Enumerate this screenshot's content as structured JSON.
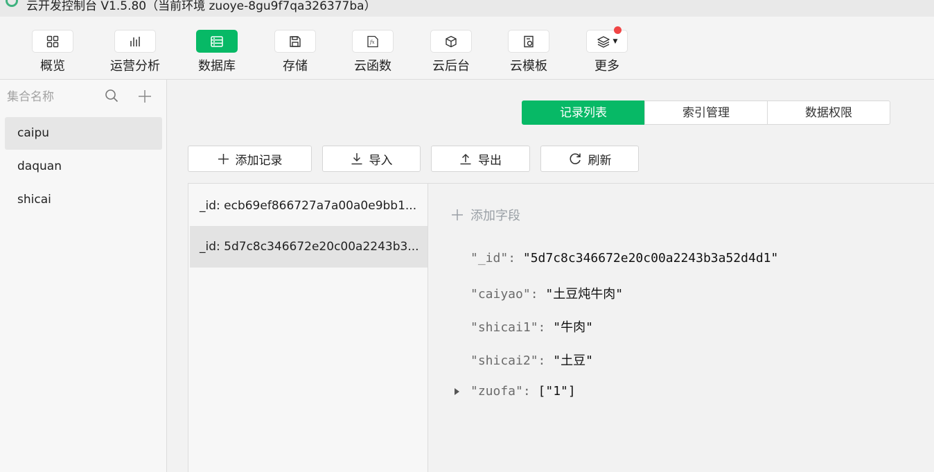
{
  "window": {
    "title": "云开发控制台 V1.5.80（当前环境 zuoye-8gu9f7qa326377ba）"
  },
  "toolbar": {
    "items": [
      {
        "label": "概览",
        "icon": "overview-grid-icon"
      },
      {
        "label": "运营分析",
        "icon": "bar-chart-icon"
      },
      {
        "label": "数据库",
        "icon": "database-icon"
      },
      {
        "label": "存储",
        "icon": "storage-save-icon"
      },
      {
        "label": "云函数",
        "icon": "function-fx-icon"
      },
      {
        "label": "云后台",
        "icon": "cube-icon"
      },
      {
        "label": "云模板",
        "icon": "template-icon"
      },
      {
        "label": "更多",
        "icon": "layers-icon"
      }
    ],
    "active": "数据库",
    "accent_color": "#07b966",
    "notification_dot_color": "#f04545"
  },
  "sidebar": {
    "search_placeholder": "集合名称",
    "collections": [
      {
        "name": "caipu",
        "selected": true
      },
      {
        "name": "daquan",
        "selected": false
      },
      {
        "name": "shicai",
        "selected": false
      }
    ]
  },
  "main": {
    "tabs": [
      {
        "label": "记录列表",
        "active": true
      },
      {
        "label": "索引管理",
        "active": false
      },
      {
        "label": "数据权限",
        "active": false
      }
    ],
    "actions": {
      "add_record": "添加记录",
      "import": "导入",
      "export": "导出",
      "refresh": "刷新"
    },
    "records": [
      {
        "label": "_id: ecb69ef866727a7a00a0e9bb1...",
        "selected": false
      },
      {
        "label": "_id: 5d7c8c346672e20c00a2243b3...",
        "selected": true
      }
    ],
    "detail": {
      "add_field": "添加字段",
      "fields": [
        {
          "key": "\"_id\"",
          "value": "\"5d7c8c346672e20c00a2243b3a52d4d1\"",
          "expandable": false
        },
        {
          "key": "\"caiyao\"",
          "value": "\"土豆炖牛肉\"",
          "expandable": false
        },
        {
          "key": "\"shicai1\"",
          "value": "\"牛肉\"",
          "expandable": false
        },
        {
          "key": "\"shicai2\"",
          "value": "\"土豆\"",
          "expandable": false
        },
        {
          "key": "\"zuofa\"",
          "value": "[\"1\"]",
          "expandable": true
        }
      ]
    }
  }
}
